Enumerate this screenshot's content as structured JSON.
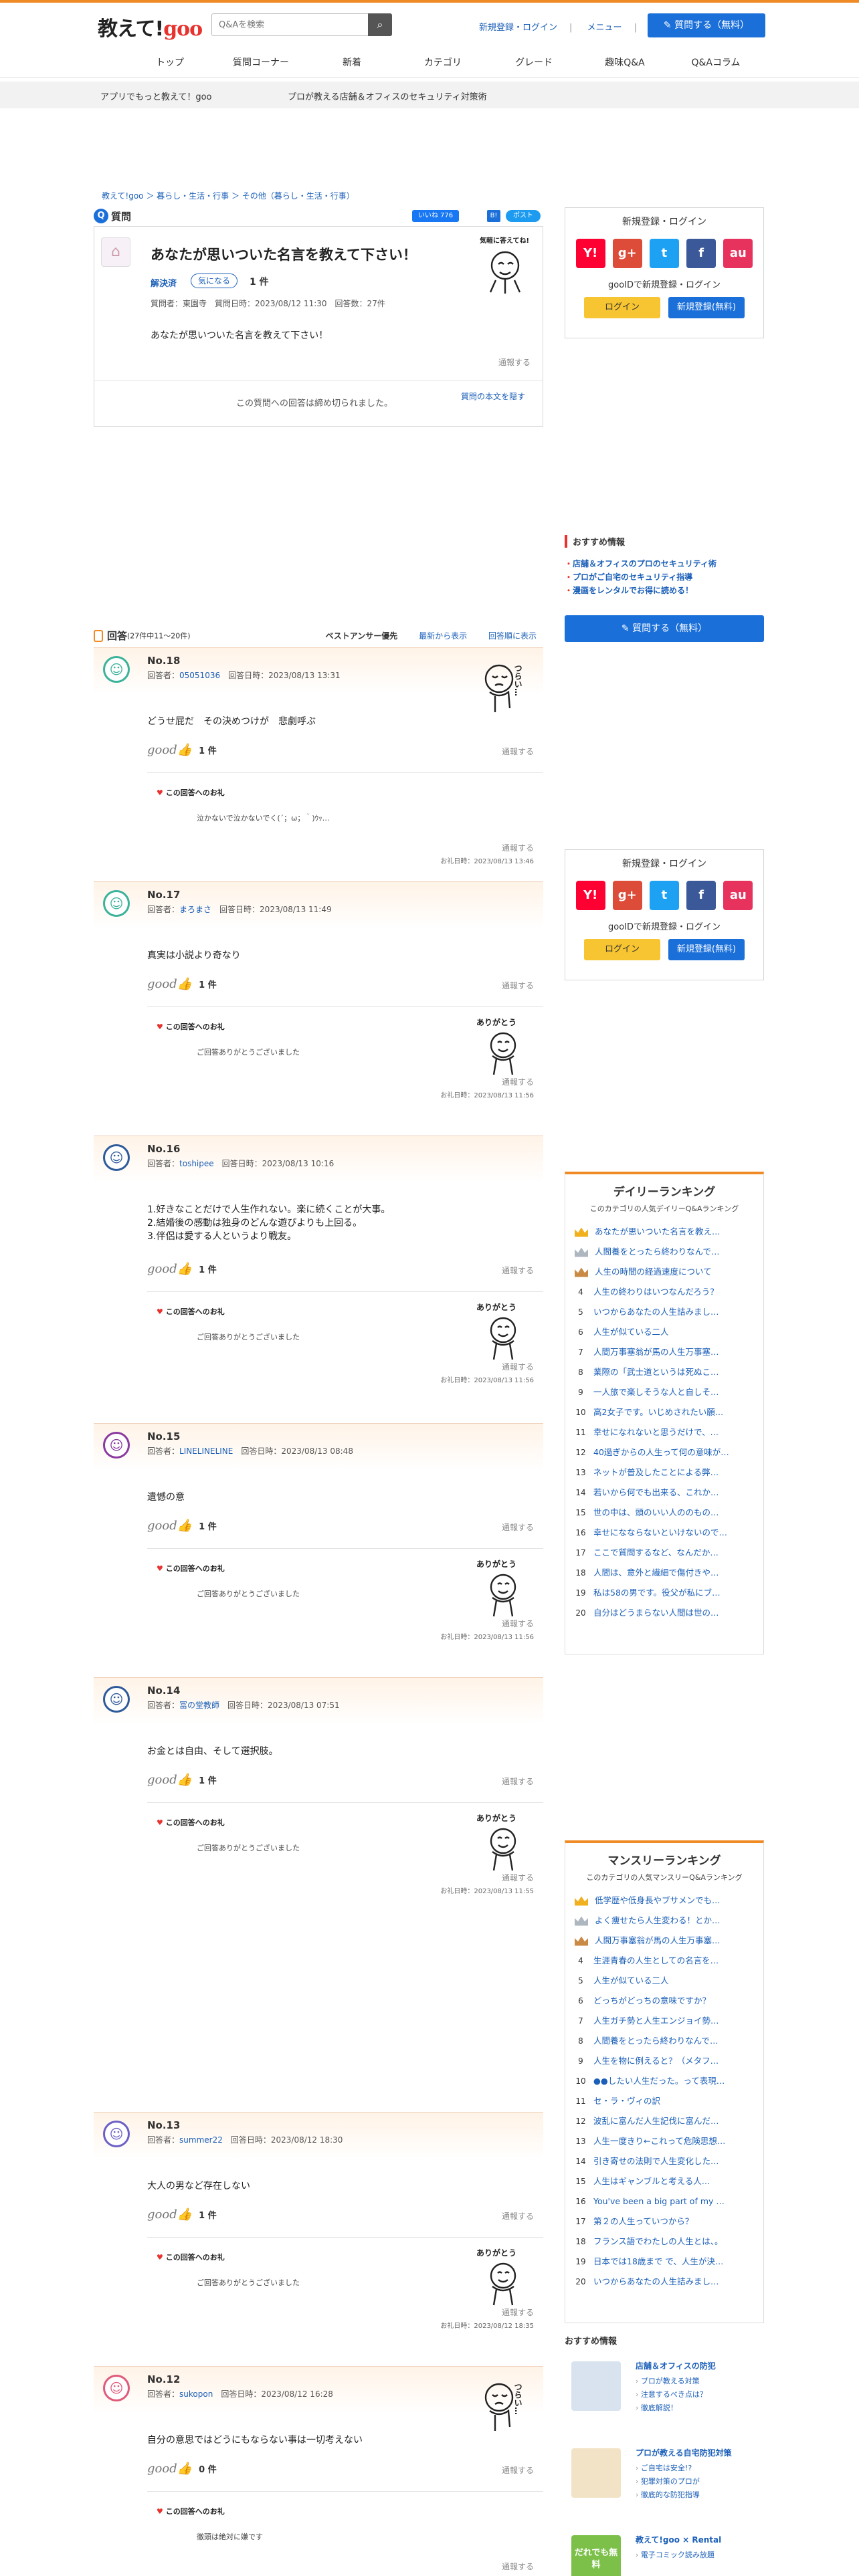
{
  "header": {
    "logo_main": "教えて!",
    "logo_goo": "goo",
    "search_placeholder": "Q&Aを検索",
    "login_link": "新規登録・ログイン",
    "menu_link": "メニュー",
    "ask_button": "質問する（無料）"
  },
  "nav": [
    "トップ",
    "質問コーナー",
    "新着",
    "カテゴリ",
    "グレード",
    "趣味Q&A",
    "Q&Aコラム"
  ],
  "subbar": {
    "left": "アプリでもっと教えて！goo",
    "right": "プロが教える店舗＆オフィスのセキュリティ対策術"
  },
  "breadcrumb": "教えて!goo ＞ 暮らし・生活・行事 ＞ その他（暮らし・生活・行事）",
  "question": {
    "label": "質問",
    "like": "いいね 776",
    "bookmark": "B!",
    "tweet": "ポスト 500",
    "title": "あなたが思いついた名言を教えて下さい！",
    "status": "解決済",
    "fav_button": "気になる",
    "fav_count": "1 件",
    "meta": "質問者：東園寺　質問日時：2023/08/12 11:30　回答数：27件",
    "body": "あなたが思いついた名言を教えて下さい！",
    "report": "通報する",
    "closed": "この質問への回答は締め切られました。",
    "show_body": "質問の本文を隠す",
    "bubble": "気軽に答えてね!"
  },
  "answers_header": {
    "label": "回答",
    "count": "(27件中11〜20件)",
    "sorts": [
      "ベストアンサー優先",
      "最新から表示",
      "回答順に表示"
    ]
  },
  "answers": [
    {
      "no": "No.18",
      "meta_prefix": "回答者：",
      "user": "05051036",
      "date": "回答日時：2023/08/13 13:31",
      "body": "どうせ屁だ　その決めつけが　悲劇呼ぶ",
      "good": "1 件",
      "report": "通報する",
      "thanks_label": "この回答へのお礼",
      "thanks": "泣かないで泣かないでく(´；ω；｀)ｳｯ…",
      "thanks_date": "お礼日時：2023/08/13 13:46"
    },
    {
      "no": "No.17",
      "meta_prefix": "回答者：",
      "user": "まろまさ",
      "date": "回答日時：2023/08/13 11:49",
      "body": "真実は小説より奇なり",
      "good": "1 件",
      "report": "通報する",
      "thanks_label": "この回答へのお礼",
      "thanks": "ご回答ありがとうございました",
      "thanks_date": "お礼日時：2023/08/13 11:56"
    },
    {
      "no": "No.16",
      "meta_prefix": "回答者：",
      "user": "toshipee",
      "date": "回答日時：2023/08/13 10:16",
      "body": "1.好きなことだけで人生作れない。楽に続くことが大事。\n2.結婚後の感動は独身のどんな遊びよりも上回る。\n3.伴侶は愛する人というより戦友。",
      "good": "1 件",
      "report": "通報する",
      "thanks_label": "この回答へのお礼",
      "thanks": "ご回答ありがとうございました",
      "thanks_date": "お礼日時：2023/08/13 11:56"
    },
    {
      "no": "No.15",
      "meta_prefix": "回答者：",
      "user": "LINELINELINE",
      "date": "回答日時：2023/08/13 08:48",
      "body": "遺憾の意",
      "good": "1 件",
      "report": "通報する",
      "thanks_label": "この回答へのお礼",
      "thanks": "ご回答ありがとうございました",
      "thanks_date": "お礼日時：2023/08/13 11:56"
    },
    {
      "no": "No.14",
      "meta_prefix": "回答者：",
      "user": "冨の堂教師",
      "date": "回答日時：2023/08/13 07:51",
      "body": "お金とは自由、そして選択肢。",
      "good": "1 件",
      "report": "通報する",
      "thanks_label": "この回答へのお礼",
      "thanks": "ご回答ありがとうございました",
      "thanks_date": "お礼日時：2023/08/13 11:55"
    },
    {
      "no": "No.13",
      "meta_prefix": "回答者：",
      "user": "summer22",
      "date": "回答日時：2023/08/12 18:30",
      "body": "大人の男など存在しない",
      "good": "1 件",
      "report": "通報する",
      "thanks_label": "この回答へのお礼",
      "thanks": "ご回答ありがとうございました",
      "thanks_date": "お礼日時：2023/08/12 18:35"
    },
    {
      "no": "No.12",
      "meta_prefix": "回答者：",
      "user": "sukopon",
      "date": "回答日時：2023/08/12 16:28",
      "body": "自分の意思ではどうにもならない事は一切考えない",
      "good": "0 件",
      "report": "通報する",
      "thanks_label": "この回答へのお礼",
      "thanks": "徹頭は絶対に嫌です",
      "thanks_date": ""
    }
  ],
  "sidebar": {
    "login_title": "新規登録・ログイン",
    "goo_id_text": "gooIDで新規登録・ログイン",
    "login_button": "ログイン",
    "register_button": "新規登録(無料)",
    "reco_title": "おすすめ情報",
    "reco_items": [
      "店舗＆オフィスのプロのセキュリティ術",
      "プロがご自宅のセキュリティ指導",
      "漫画をレンタルでお得に読める！"
    ],
    "ask_button": "質問する（無料）",
    "sns": [
      "Y!",
      "g+",
      "t",
      "f",
      "au"
    ],
    "colors": {
      "yahoo": "#ff0033",
      "google": "#dd4b39",
      "twitter": "#1da1f2",
      "facebook": "#3b5998",
      "au": "#e8325e"
    }
  },
  "daily_ranking": {
    "title": "デイリーランキング",
    "subtitle": "このカテゴリの人気デイリーQ&Aランキング",
    "items": [
      "あなたが思いついた名言を教え…",
      "人間養をとったら終わりなんで…",
      "人生の時間の経過速度について",
      "人生の終わりはいつなんだろう？",
      "いつからあなたの人生詰みまし…",
      "人生が似ている二人",
      "人間万事塞翁が馬の人生万事塞…",
      "業際の「武士道というは死ぬこ…",
      "一人旅で楽しそうな人と自しそ…",
      "高2女子です。いじめされたい願…",
      "幸せになれないと思うだけで、…",
      "40過ぎからの人生って何の意味が…",
      "ネットが普及したことによる弊…",
      "若いから何でも出来る、これか…",
      "世の中は、頭のいい人ののもの…",
      "幸せになならないといけないので…",
      "ここで質問するなど、なんだか…",
      "人間は、意外と繊細で傷付きや…",
      "私は58の男です。役父が私にブ…",
      "自分はどうまらない人間は世の…"
    ]
  },
  "monthly_ranking": {
    "title": "マンスリーランキング",
    "subtitle": "このカテゴリの人気マンスリーQ&Aランキング",
    "items": [
      "低学歴や低身長やブサメンでも…",
      "よく痩せたら人生変わる！とか…",
      "人間万事塞翁が馬の人生万事塞…",
      "生涯青春の人生としての名言を…",
      "人生が似ている二人",
      "どっちがどっちの意味ですか？",
      "人生ガチ勢と人生エンジョイ勢…",
      "人間養をとったら終わりなんで…",
      "人生を物に例えると？（メタフ…",
      "●●したい人生だった。って表現…",
      "セ・ラ・ヴィの訳",
      "波乱に富んだ人生記伐に富んだ…",
      "人生一度きり←これって危険思想…",
      "引き寄せの法則で人生変化した…",
      "人生はギャンブルと考える人…",
      "You've been a big part of my …",
      "第２の人生っていつから？",
      "フランス語でわたしの人生とは、。",
      "日本では18歳まで で、人生が決…",
      "いつからあなたの人生詰みまし…"
    ]
  },
  "recommend2": {
    "title": "おすすめ情報",
    "items": [
      {
        "title": "店舗＆オフィスの防犯",
        "links": [
          "プロが教える対策",
          "注意するべき点は？",
          "徹底解説！"
        ]
      },
      {
        "title": "プロが教える自宅防犯対策",
        "links": [
          "ご自宅は安全!?",
          "犯罪対策のプロが",
          "徹底的な防犯指導"
        ]
      },
      {
        "title": "教えて!goo × Rental",
        "links": [
          "電子コミック読み放題"
        ],
        "badge": "だれでも無料"
      }
    ]
  },
  "illustrations": {
    "tsurai": "つらい…",
    "arigatou": "ありがとう"
  }
}
